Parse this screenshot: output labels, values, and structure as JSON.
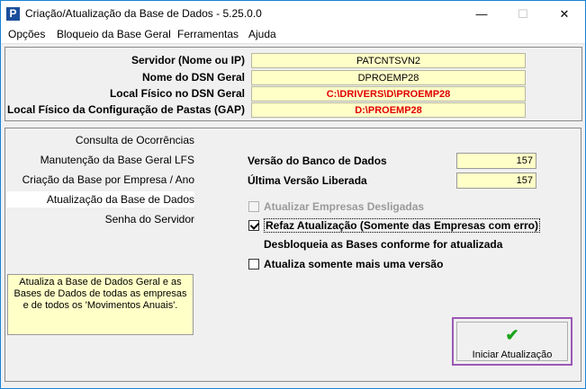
{
  "window": {
    "title": "Criação/Atualização da Base de Dados - 5.25.0.0",
    "app_icon": "P",
    "minimize": "—",
    "maximize": "☐",
    "close": "✕"
  },
  "menu": [
    "Opções",
    "Bloqueio da Base Geral",
    "Ferramentas",
    "Ajuda"
  ],
  "info": {
    "servidor_label": "Servidor (Nome ou IP)",
    "servidor_value": "PATCNTSVN2",
    "dsn_label": "Nome do DSN Geral",
    "dsn_value": "DPROEMP28",
    "local_dsn_label": "Local Físico no DSN Geral",
    "local_dsn_value": "C:\\DRIVERS\\D\\PROEMP28",
    "local_gap_label": "Local Físico da Configuração de Pastas (GAP)",
    "local_gap_value": "D:\\PROEMP28"
  },
  "nav": {
    "items": [
      "Consulta de Ocorrências",
      "Manutenção da Base Geral LFS",
      "Criação da Base por Empresa / Ano",
      "Atualização da Base de Dados",
      "Senha do Servidor"
    ],
    "selected_index": 3,
    "description": "Atualiza a Base de Dados Geral e as Bases de Dados de todas as empresas e de todos os 'Movimentos Anuais'."
  },
  "main": {
    "versao_label": "Versão do Banco de Dados",
    "versao_value": "157",
    "ultima_label": "Última Versão Liberada",
    "ultima_value": "157",
    "cb_desligadas": "Atualizar Empresas Desligadas",
    "cb_refaz": "Refaz Atualização (Somente das Empresas com erro)",
    "desbloqueia": "Desbloqueia as Bases conforme for atualizada",
    "cb_uma_versao": "Atualiza somente mais uma versão",
    "run_button": "Iniciar Atualização",
    "run_icon": "✔"
  }
}
